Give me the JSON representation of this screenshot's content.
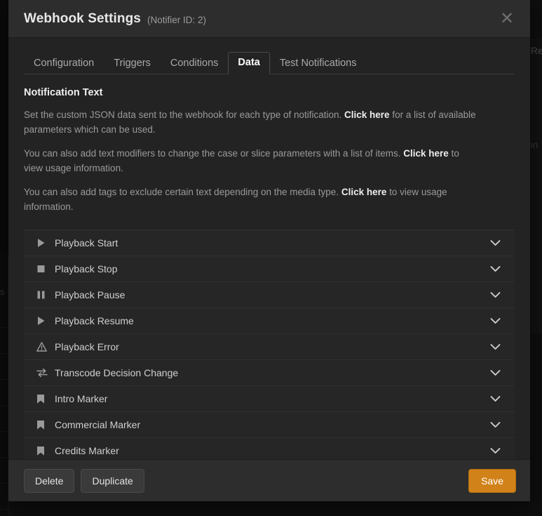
{
  "background": {
    "fragment_right_top": "Re",
    "fragment_right_mid": "on",
    "fragment_left": "s"
  },
  "modal": {
    "title": "Webhook Settings",
    "subtitle": "(Notifier ID: 2)",
    "close_label": "✕"
  },
  "tabs": [
    {
      "label": "Configuration",
      "active": false
    },
    {
      "label": "Triggers",
      "active": false
    },
    {
      "label": "Conditions",
      "active": false
    },
    {
      "label": "Data",
      "active": true
    },
    {
      "label": "Test Notifications",
      "active": false
    }
  ],
  "content": {
    "section_title": "Notification Text",
    "paragraphs": [
      {
        "before": "Set the custom JSON data sent to the webhook for each type of notification. ",
        "link": "Click here",
        "after": " for a list of available parameters which can be used."
      },
      {
        "before": "You can also add text modifiers to change the case or slice parameters with a list of items. ",
        "link": "Click here",
        "after": " to view usage information."
      },
      {
        "before": "You can also add tags to exclude certain text depending on the media type. ",
        "link": "Click here",
        "after": " to view usage information."
      }
    ]
  },
  "accordion": {
    "chevron_glyph": "⌄",
    "items": [
      {
        "label": "Playback Start",
        "icon": "play-icon"
      },
      {
        "label": "Playback Stop",
        "icon": "stop-icon"
      },
      {
        "label": "Playback Pause",
        "icon": "pause-icon"
      },
      {
        "label": "Playback Resume",
        "icon": "play-icon"
      },
      {
        "label": "Playback Error",
        "icon": "warning-icon"
      },
      {
        "label": "Transcode Decision Change",
        "icon": "exchange-icon"
      },
      {
        "label": "Intro Marker",
        "icon": "bookmark-icon"
      },
      {
        "label": "Commercial Marker",
        "icon": "bookmark-icon"
      },
      {
        "label": "Credits Marker",
        "icon": "bookmark-icon"
      }
    ]
  },
  "footer": {
    "delete_label": "Delete",
    "duplicate_label": "Duplicate",
    "save_label": "Save"
  },
  "colors": {
    "accent": "#d18219",
    "modal_bg": "#232323",
    "header_bg": "#2d2d2d",
    "row_bg": "#262626",
    "text_primary": "#e8e8e8",
    "text_muted": "#9a9a9a"
  }
}
